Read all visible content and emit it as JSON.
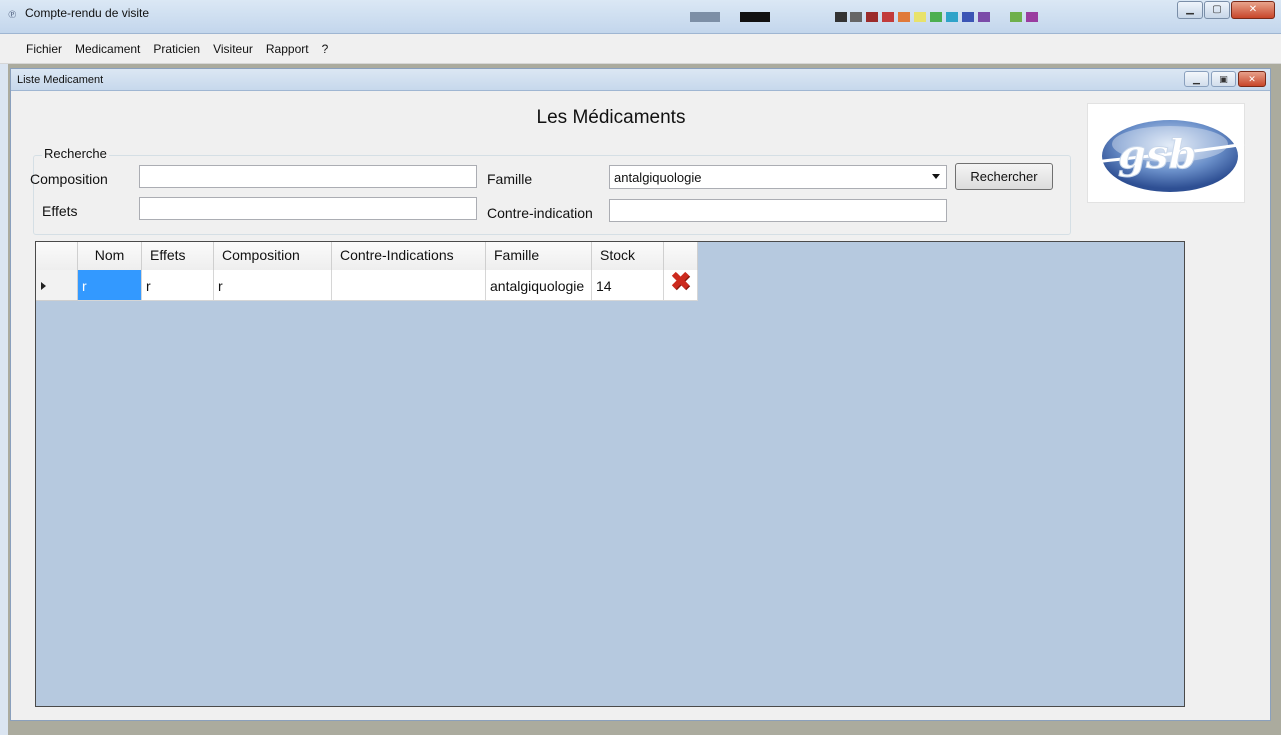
{
  "window": {
    "title": "Compte-rendu de visite"
  },
  "menu": [
    "Fichier",
    "Medicament",
    "Praticien",
    "Visiteur",
    "Rapport",
    "?"
  ],
  "child": {
    "title": "Liste Medicament"
  },
  "page_title": "Les Médicaments",
  "search": {
    "group_label": "Recherche",
    "composition_label": "Composition",
    "composition_value": "",
    "effets_label": "Effets",
    "effets_value": "",
    "famille_label": "Famille",
    "famille_selected": "antalgiquologie",
    "contre_label": "Contre-indication",
    "contre_value": "",
    "search_button": "Rechercher"
  },
  "grid": {
    "columns": [
      "Nom",
      "Effets",
      "Composition",
      "Contre-Indications",
      "Famille",
      "Stock"
    ],
    "rows": [
      {
        "nom": "r",
        "effets": "r",
        "composition": "r",
        "contre": "",
        "famille": "antalgiquologie",
        "stock": "14"
      }
    ]
  },
  "icons": {
    "delete": "delete-x-icon"
  }
}
